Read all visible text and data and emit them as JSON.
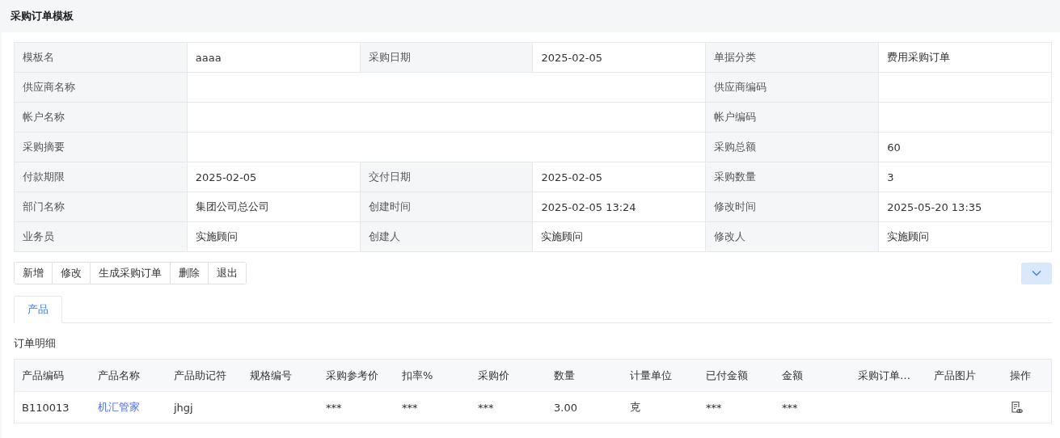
{
  "page": {
    "title": "采购订单模板"
  },
  "form": {
    "rows": [
      [
        {
          "label": "模板名",
          "value": "aaaa"
        },
        {
          "label": "采购日期",
          "value": "2025-02-05"
        },
        {
          "label": "单据分类",
          "value": "费用采购订单"
        }
      ],
      [
        {
          "label": "供应商名称",
          "wide": true
        },
        {
          "label": "供应商编码"
        }
      ],
      [
        {
          "label": "帐户名称",
          "wide": true
        },
        {
          "label": "帐户编码"
        }
      ],
      [
        {
          "label": "采购摘要",
          "wide": true
        },
        {
          "label": "采购总额",
          "value": "60"
        }
      ],
      [
        {
          "label": "付款期限",
          "value": "2025-02-05"
        },
        {
          "label": "交付日期",
          "value": "2025-02-05"
        },
        {
          "label": "采购数量",
          "value": "3"
        }
      ],
      [
        {
          "label": "部门名称",
          "value": "集团公司总公司"
        },
        {
          "label": "创建时间",
          "value": "2025-02-05 13:24"
        },
        {
          "label": "修改时间",
          "value": "2025-05-20 13:35"
        }
      ],
      [
        {
          "label": "业务员",
          "value": "实施顾问"
        },
        {
          "label": "创建人",
          "value": "实施顾问"
        },
        {
          "label": "修改人",
          "value": "实施顾问"
        }
      ]
    ]
  },
  "toolbar": {
    "buttons": [
      "新增",
      "修改",
      "生成采购订单",
      "删除",
      "退出"
    ]
  },
  "tabs": [
    {
      "label": "产品",
      "selected": true
    }
  ],
  "section_title": "订单明细",
  "table": {
    "columns": [
      "产品编码",
      "产品名称",
      "产品助记符",
      "规格编号",
      "采购参考价",
      "扣率%",
      "采购价",
      "数量",
      "计量单位",
      "已付金额",
      "金额",
      "采购订单…",
      "产品图片",
      "操作"
    ],
    "rows": [
      {
        "cells": [
          {
            "kind": "text",
            "text": "B110013"
          },
          {
            "kind": "link",
            "text": "机汇管家"
          },
          {
            "kind": "text",
            "text": "jhgj"
          },
          null,
          {
            "kind": "text",
            "text": "***"
          },
          {
            "kind": "text",
            "text": "***"
          },
          {
            "kind": "text",
            "text": "***"
          },
          {
            "kind": "text",
            "text": "3.00"
          },
          {
            "kind": "text",
            "text": "克"
          },
          {
            "kind": "text",
            "text": "***"
          },
          {
            "kind": "text",
            "text": "***"
          },
          null,
          null,
          {
            "kind": "action"
          }
        ]
      }
    ]
  }
}
